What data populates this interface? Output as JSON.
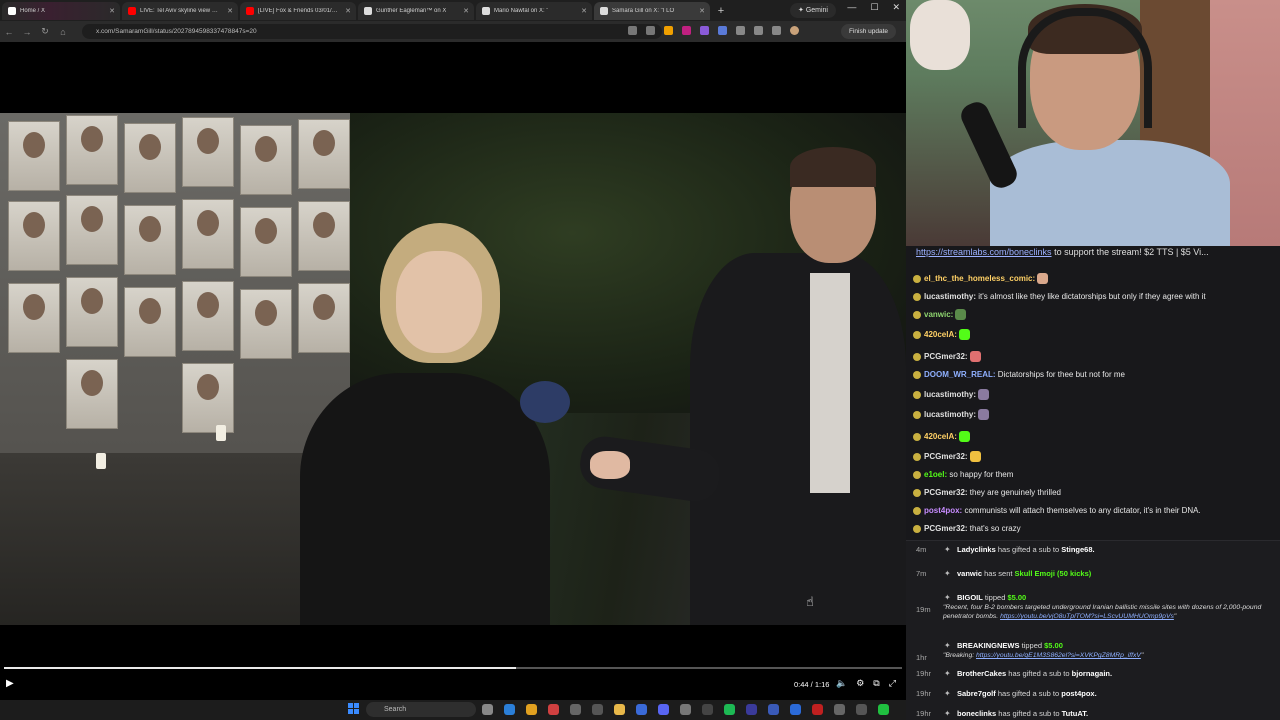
{
  "browser": {
    "tabs": [
      {
        "label": "Home / X",
        "color": "#ffffff"
      },
      {
        "label": "LIVE: Tel Aviv skyline view as Isr",
        "color": "#ff0000"
      },
      {
        "label": "[LIVE] Fox & Friends 03/01/20",
        "color": "#ff0000"
      },
      {
        "label": "Gunther Eagleman™ on X",
        "color": "#ffffff"
      },
      {
        "label": "Mario Nawfal on X: \"",
        "color": "#ffffff"
      },
      {
        "label": "Samara Gill on X: \"I LO",
        "color": "#ffffff"
      }
    ],
    "gemini_label": "Gemini",
    "url": "x.com/SamaramGill/status/2027894598337478847s=20",
    "finish_update": "Finish update"
  },
  "video": {
    "time": "0:44 / 1:16",
    "progress": 0.57
  },
  "taskbar": {
    "search_label": "Search"
  },
  "chat": {
    "banner_link": "https://streamlabs.com/boneclinks",
    "banner_text": " to support the stream! $2 TTS | $5 Vi...",
    "messages": [
      {
        "user": "el_thc_the_homeless_comic:",
        "text": "",
        "color": "#ffd166",
        "emote": "#d9a88c"
      },
      {
        "user": "lucastimothy:",
        "text": "it's almost like they like dictatorships but only if they agree with it",
        "color": "#e0e0e0",
        "emote": ""
      },
      {
        "user": "vanwic:",
        "text": "",
        "color": "#8ed46f",
        "emote": "#5a8a4a"
      },
      {
        "user": "420celA:",
        "text": "",
        "color": "#ffd166",
        "emote": "#53fc18"
      },
      {
        "user": "PCGmer32:",
        "text": "",
        "color": "#e0e0e0",
        "emote": "#e07070"
      },
      {
        "user": "DOOM_WR_REAL:",
        "text": "Dictatorships for thee but not for me",
        "color": "#8fb0ff",
        "emote": ""
      },
      {
        "user": "lucastimothy:",
        "text": "",
        "color": "#e0e0e0",
        "emote": "#8a7aa0"
      },
      {
        "user": "lucastimothy:",
        "text": "",
        "color": "#e0e0e0",
        "emote": "#8a7aa0"
      },
      {
        "user": "420celA:",
        "text": "",
        "color": "#ffd166",
        "emote": "#53fc18"
      },
      {
        "user": "PCGmer32:",
        "text": "",
        "color": "#e0e0e0",
        "emote": "#f0c040"
      },
      {
        "user": "e1oel:",
        "text": "so happy for them",
        "color": "#53fc18",
        "emote": ""
      },
      {
        "user": "PCGmer32:",
        "text": "they are genuinely thrilled",
        "color": "#e0e0e0",
        "emote": ""
      },
      {
        "user": "post4pox:",
        "text": "communists will attach themselves to any dictator, it's in their DNA.",
        "color": "#c78cff",
        "emote": ""
      },
      {
        "user": "PCGmer32:",
        "text": "that's so crazy",
        "color": "#e0e0e0",
        "emote": ""
      }
    ],
    "activity": [
      {
        "age": "4m",
        "user": "Ladyclinks",
        "text": " has gifted a sub to ",
        "target": "Stinge68."
      },
      {
        "age": "7m",
        "user": "vanwic",
        "text": " has sent ",
        "target": "Skull Emoji (50 kicks)"
      },
      {
        "age": "19m",
        "user": "BIGOIL",
        "text": " tipped ",
        "target": "$5.00",
        "quote": "\"Recent, four B-2 bombers targeted underground Iranian ballistic missile sites with dozens of 2,000-pound penetrator bombs.",
        "quote_link": "https://youtu.be/vjO8uTplTOM?si=LScvUUMHUOmp9pVs"
      },
      {
        "age": "1hr",
        "user": "BREAKINGNEWS",
        "text": " tipped ",
        "target": "$5.00",
        "quote": "\"Breaking: ",
        "quote_link": "https://youtu.be/qE1M3S862el?si=XVKPgZ8MRp_iffxV"
      },
      {
        "age": "19hr",
        "user": "BrotherCakes",
        "text": " has gifted a sub to ",
        "target": "bjornagain."
      },
      {
        "age": "19hr",
        "user": "Sabre7golf",
        "text": " has gifted a sub to ",
        "target": "post4pox."
      },
      {
        "age": "19hr",
        "user": "boneclinks",
        "text": " has gifted a sub to ",
        "target": "TutuAT."
      }
    ]
  }
}
